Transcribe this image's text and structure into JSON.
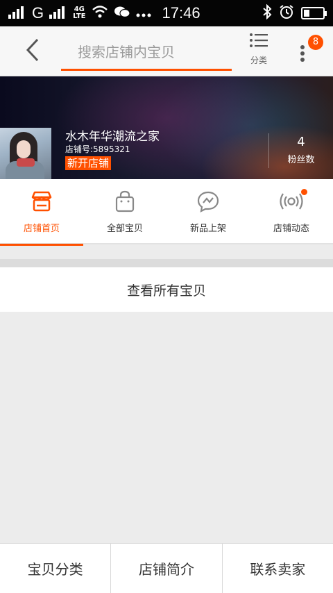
{
  "status_bar": {
    "time": "17:46",
    "network": "G",
    "network_4g_top": "4G",
    "network_4g_bottom": "LTE",
    "icons": [
      "signal-icon",
      "wifi-icon",
      "wechat-icon",
      "more-dots-icon",
      "bluetooth-icon",
      "alarm-icon",
      "battery-icon"
    ]
  },
  "header": {
    "search_placeholder": "搜索店铺内宝贝",
    "category_label": "分类",
    "notification_count": "8"
  },
  "shop": {
    "name": "水木年华潮流之家",
    "id_text": "店铺号:5895321",
    "tag": "新开店铺",
    "fans_count": "4",
    "fans_label": "粉丝数"
  },
  "tabs": [
    {
      "label": "店铺首页",
      "icon": "storefront-icon",
      "active": true
    },
    {
      "label": "全部宝贝",
      "icon": "shopping-bag-icon",
      "active": false
    },
    {
      "label": "新品上架",
      "icon": "chat-bubble-icon",
      "active": false
    },
    {
      "label": "店铺动态",
      "icon": "broadcast-icon",
      "active": false
    }
  ],
  "main": {
    "view_all_label": "查看所有宝贝"
  },
  "bottom_bar": {
    "items": [
      "宝贝分类",
      "店铺简介",
      "联系卖家"
    ]
  },
  "colors": {
    "accent": "#ff5000",
    "background": "#ececec"
  }
}
